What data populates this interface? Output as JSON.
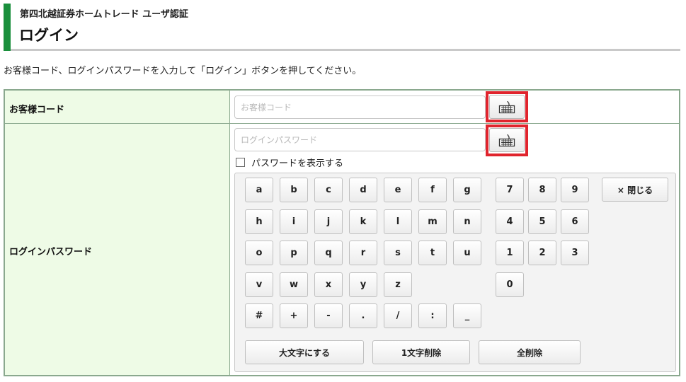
{
  "header": {
    "subtitle": "第四北越証券ホームトレード ユーザ認証",
    "title": "ログイン",
    "accent_color": "#1a8f3c"
  },
  "instruction": "お客様コード、ログインパスワードを入力して「ログイン」ボタンを押してください。",
  "form": {
    "customer_code": {
      "label": "お客様コード",
      "placeholder": "お客様コード",
      "value": ""
    },
    "password": {
      "label": "ログインパスワード",
      "placeholder": "ログインパスワード",
      "value": "",
      "show_password_label": "パスワードを表示する",
      "show_password_checked": false
    },
    "software_keyboard_icon": "keyboard-icon",
    "highlight_color": "#e0242d"
  },
  "keypad": {
    "letter_rows": [
      [
        "a",
        "b",
        "c",
        "d",
        "e",
        "f",
        "g"
      ],
      [
        "h",
        "i",
        "j",
        "k",
        "l",
        "m",
        "n"
      ],
      [
        "o",
        "p",
        "q",
        "r",
        "s",
        "t",
        "u"
      ],
      [
        "v",
        "w",
        "x",
        "y",
        "z"
      ],
      [
        "#",
        "+",
        "-",
        ".",
        "/",
        ":",
        "_"
      ]
    ],
    "digit_rows": [
      [
        "7",
        "8",
        "9"
      ],
      [
        "4",
        "5",
        "6"
      ],
      [
        "1",
        "2",
        "3"
      ],
      [
        "0"
      ]
    ],
    "close_label": "× 閉じる",
    "uppercase_label": "大文字にする",
    "delete_one_label": "1文字削除",
    "delete_all_label": "全削除"
  }
}
